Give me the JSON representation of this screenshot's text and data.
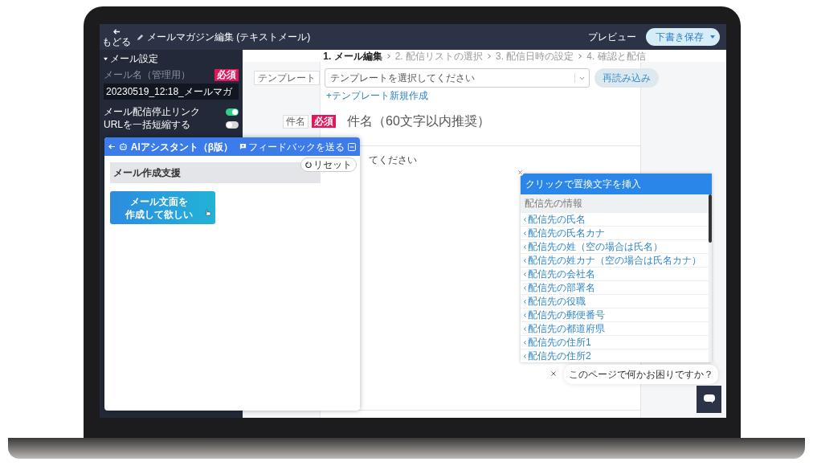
{
  "topbar": {
    "back_label": "もどる",
    "title": "メールマガジン編集 (テキストメール)",
    "preview": "プレビュー",
    "save": "下書き保存"
  },
  "sidebar": {
    "section": "メール設定",
    "expanded": true,
    "name_label": "メール名（管理用）",
    "required": "必須",
    "name_value": "20230519_12:18_メールマガ",
    "toggles": [
      {
        "label": "メール配信停止リンク",
        "on": true
      },
      {
        "label": "URLを一括短縮する",
        "on": false
      }
    ]
  },
  "steps": [
    {
      "label": "1. メール編集",
      "selected": true
    },
    {
      "label": "2. 配信リストの選択",
      "selected": false
    },
    {
      "label": "3. 配信日時の設定",
      "selected": false
    },
    {
      "label": "4. 確認と配信",
      "selected": false
    }
  ],
  "template": {
    "label": "テンプレート",
    "placeholder": "テンプレートを選択してください",
    "reload": "再読み込み",
    "new_link": "+テンプレート新規作成"
  },
  "subject": {
    "label": "件名",
    "required": "必須",
    "placeholder": "件名（60文字以内推奨）"
  },
  "body": {
    "text": "てください"
  },
  "ai_panel": {
    "title": "AIアシスタント（β版）",
    "feedback": "フィードバックを送る",
    "topic": "メール作成支援",
    "reset": "リセット",
    "suggestion_lines": [
      "メール文面を",
      "作成して欲しい"
    ]
  },
  "insert_popup": {
    "title": "クリックで置換文字を挿入",
    "group": "配信先の情報",
    "items": [
      "配信先の氏名",
      "配信先の氏名カナ",
      "配信先の姓（空の場合は氏名）",
      "配信先の姓カナ（空の場合は氏名カナ）",
      "配信先の会社名",
      "配信先の部署名",
      "配信先の役職",
      "配信先の郵便番号",
      "配信先の都道府県",
      "配信先の住所1",
      "配信先の住所2"
    ]
  },
  "chat": {
    "prompt": "このページで何かお困りですか？"
  }
}
